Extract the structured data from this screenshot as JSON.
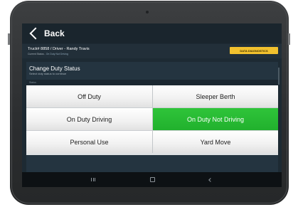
{
  "header": {
    "back_label": "Back"
  },
  "info": {
    "truck_driver": "Truck# 8858 / Driver - Randy Travis",
    "current_status_label": "Current Status - ",
    "current_status_value": "On Duty Not Driving",
    "diagnostics_button": "DATA DIAGNOSTICS"
  },
  "panel": {
    "title": "Change Duty Status",
    "subtitle": "Select duty status to continue",
    "status_label": "Status"
  },
  "statuses": [
    {
      "label": "Off Duty",
      "active": false
    },
    {
      "label": "Sleeper Berth",
      "active": false
    },
    {
      "label": "On Duty Driving",
      "active": false
    },
    {
      "label": "On Duty Not Driving",
      "active": true
    },
    {
      "label": "Personal Use",
      "active": false
    },
    {
      "label": "Yard Move",
      "active": false
    }
  ],
  "colors": {
    "active_status": "#22b22e",
    "diagnostics_button": "#f2c12e",
    "screen_background": "#1d2a33"
  },
  "nav_icons": [
    "recents-icon",
    "home-icon",
    "back-icon"
  ]
}
